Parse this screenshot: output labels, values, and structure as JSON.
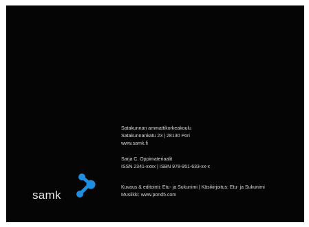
{
  "colophon": {
    "institution": {
      "name": "Satakunnan ammattikorkeakoulu",
      "address": "Satakunnankatu 23  |  28130 Pori",
      "website": "www.samk.fi"
    },
    "series": {
      "name": "Sarja C. Oppimateriaalit",
      "identifiers": "ISSN 2341-xxxx  |  ISBN 978-951-633-xx-x"
    },
    "credits": {
      "editing": "Kuvaus & editointi: Etu- ja Sukunimi  |  Käsikirjoitus: Etu- ja Sukunimi",
      "music": "Musiikki: www.pond5.com"
    }
  },
  "logo": {
    "wordmark": "samk",
    "mark_color": "#1e8ee0",
    "wordmark_color": "#e6e6e6"
  },
  "colors": {
    "background": "#050505",
    "text": "#d8d8d8"
  }
}
